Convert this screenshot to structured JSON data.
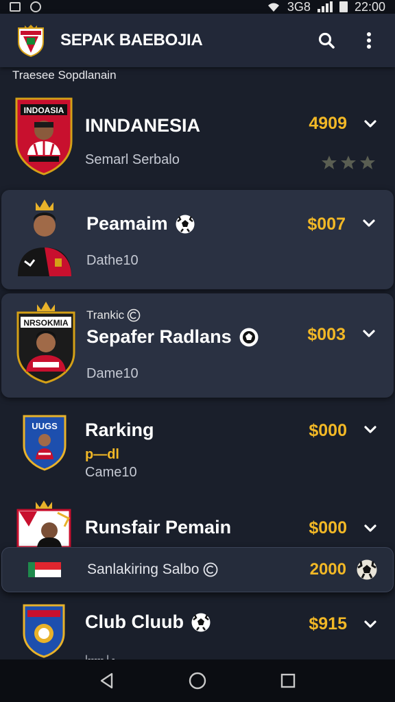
{
  "status_bar": {
    "carrier_text": "3G8",
    "time": "22:00"
  },
  "app_bar": {
    "title": "SEPAK BAEBOJIA",
    "search_label": "search",
    "menu_label": "more"
  },
  "section": {
    "label": "Traesee Sopdlanain"
  },
  "colors": {
    "accent": "#f2b826",
    "background": "#1a1f2b",
    "card": "#2a3142"
  },
  "items": [
    {
      "name": "INNDANESIA",
      "sub": "Semarl Serbalo",
      "price": "4909",
      "badge_text": "INDOASIA",
      "rating": 3
    },
    {
      "name": "Peamaim",
      "sub": "Dathe10",
      "price": "$007"
    },
    {
      "kicker": "Trankic",
      "name": "Sepafer Radlans",
      "sub": "Dame10",
      "price": "$003",
      "badge_text": "NRSOKMIA"
    },
    {
      "name": "Rarking",
      "tag": "p—dl",
      "sub": "Came10",
      "price": "$000",
      "badge_text": "UUGS"
    },
    {
      "name": "Runsfair Pemain",
      "price": "$000"
    },
    {
      "name": "Club Cluub",
      "sub": "I----- I -",
      "price": "$915"
    }
  ],
  "promo": {
    "text": "Sanlakiring Salbo",
    "price": "2000"
  },
  "nav": {
    "back": "back",
    "home": "home",
    "recents": "recents"
  }
}
